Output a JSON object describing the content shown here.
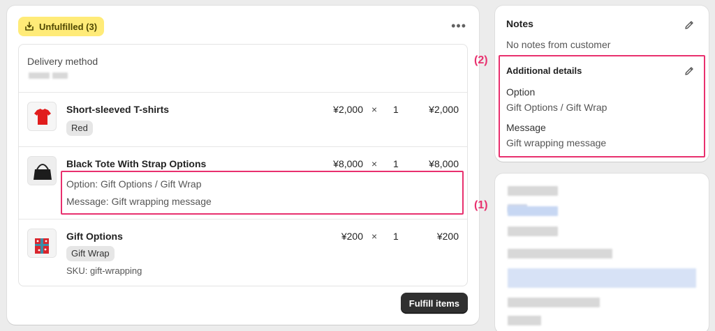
{
  "fulfillment": {
    "badge_label": "Unfulfilled (3)",
    "more_label": "•••",
    "delivery_label": "Delivery method",
    "fulfill_button": "Fulfill items"
  },
  "items": [
    {
      "name": "Short-sleeved T-shirts",
      "variant": "Red",
      "price": "¥2,000",
      "times": "×",
      "qty": "1",
      "total": "¥2,000"
    },
    {
      "name": "Black Tote With Strap Options",
      "price": "¥8,000",
      "times": "×",
      "qty": "1",
      "total": "¥8,000",
      "option_line": "Option: Gift Options / Gift Wrap",
      "message_line": "Message: Gift wrapping message"
    },
    {
      "name": "Gift Options",
      "variant": "Gift Wrap",
      "sku": "SKU: gift-wrapping",
      "price": "¥200",
      "times": "×",
      "qty": "1",
      "total": "¥200"
    }
  ],
  "notes": {
    "title": "Notes",
    "empty": "No notes from customer",
    "additional_title": "Additional details",
    "option_label": "Option",
    "option_value": "Gift Options / Gift Wrap",
    "message_label": "Message",
    "message_value": "Gift wrapping message"
  },
  "annotations": {
    "one": "(1)",
    "two": "(2)"
  },
  "colors": {
    "highlight": "#e8306e",
    "badge_bg": "#ffeb78",
    "button_bg": "#303030"
  },
  "icons": [
    "unfulfilled-icon",
    "more-icon",
    "pencil-icon"
  ]
}
